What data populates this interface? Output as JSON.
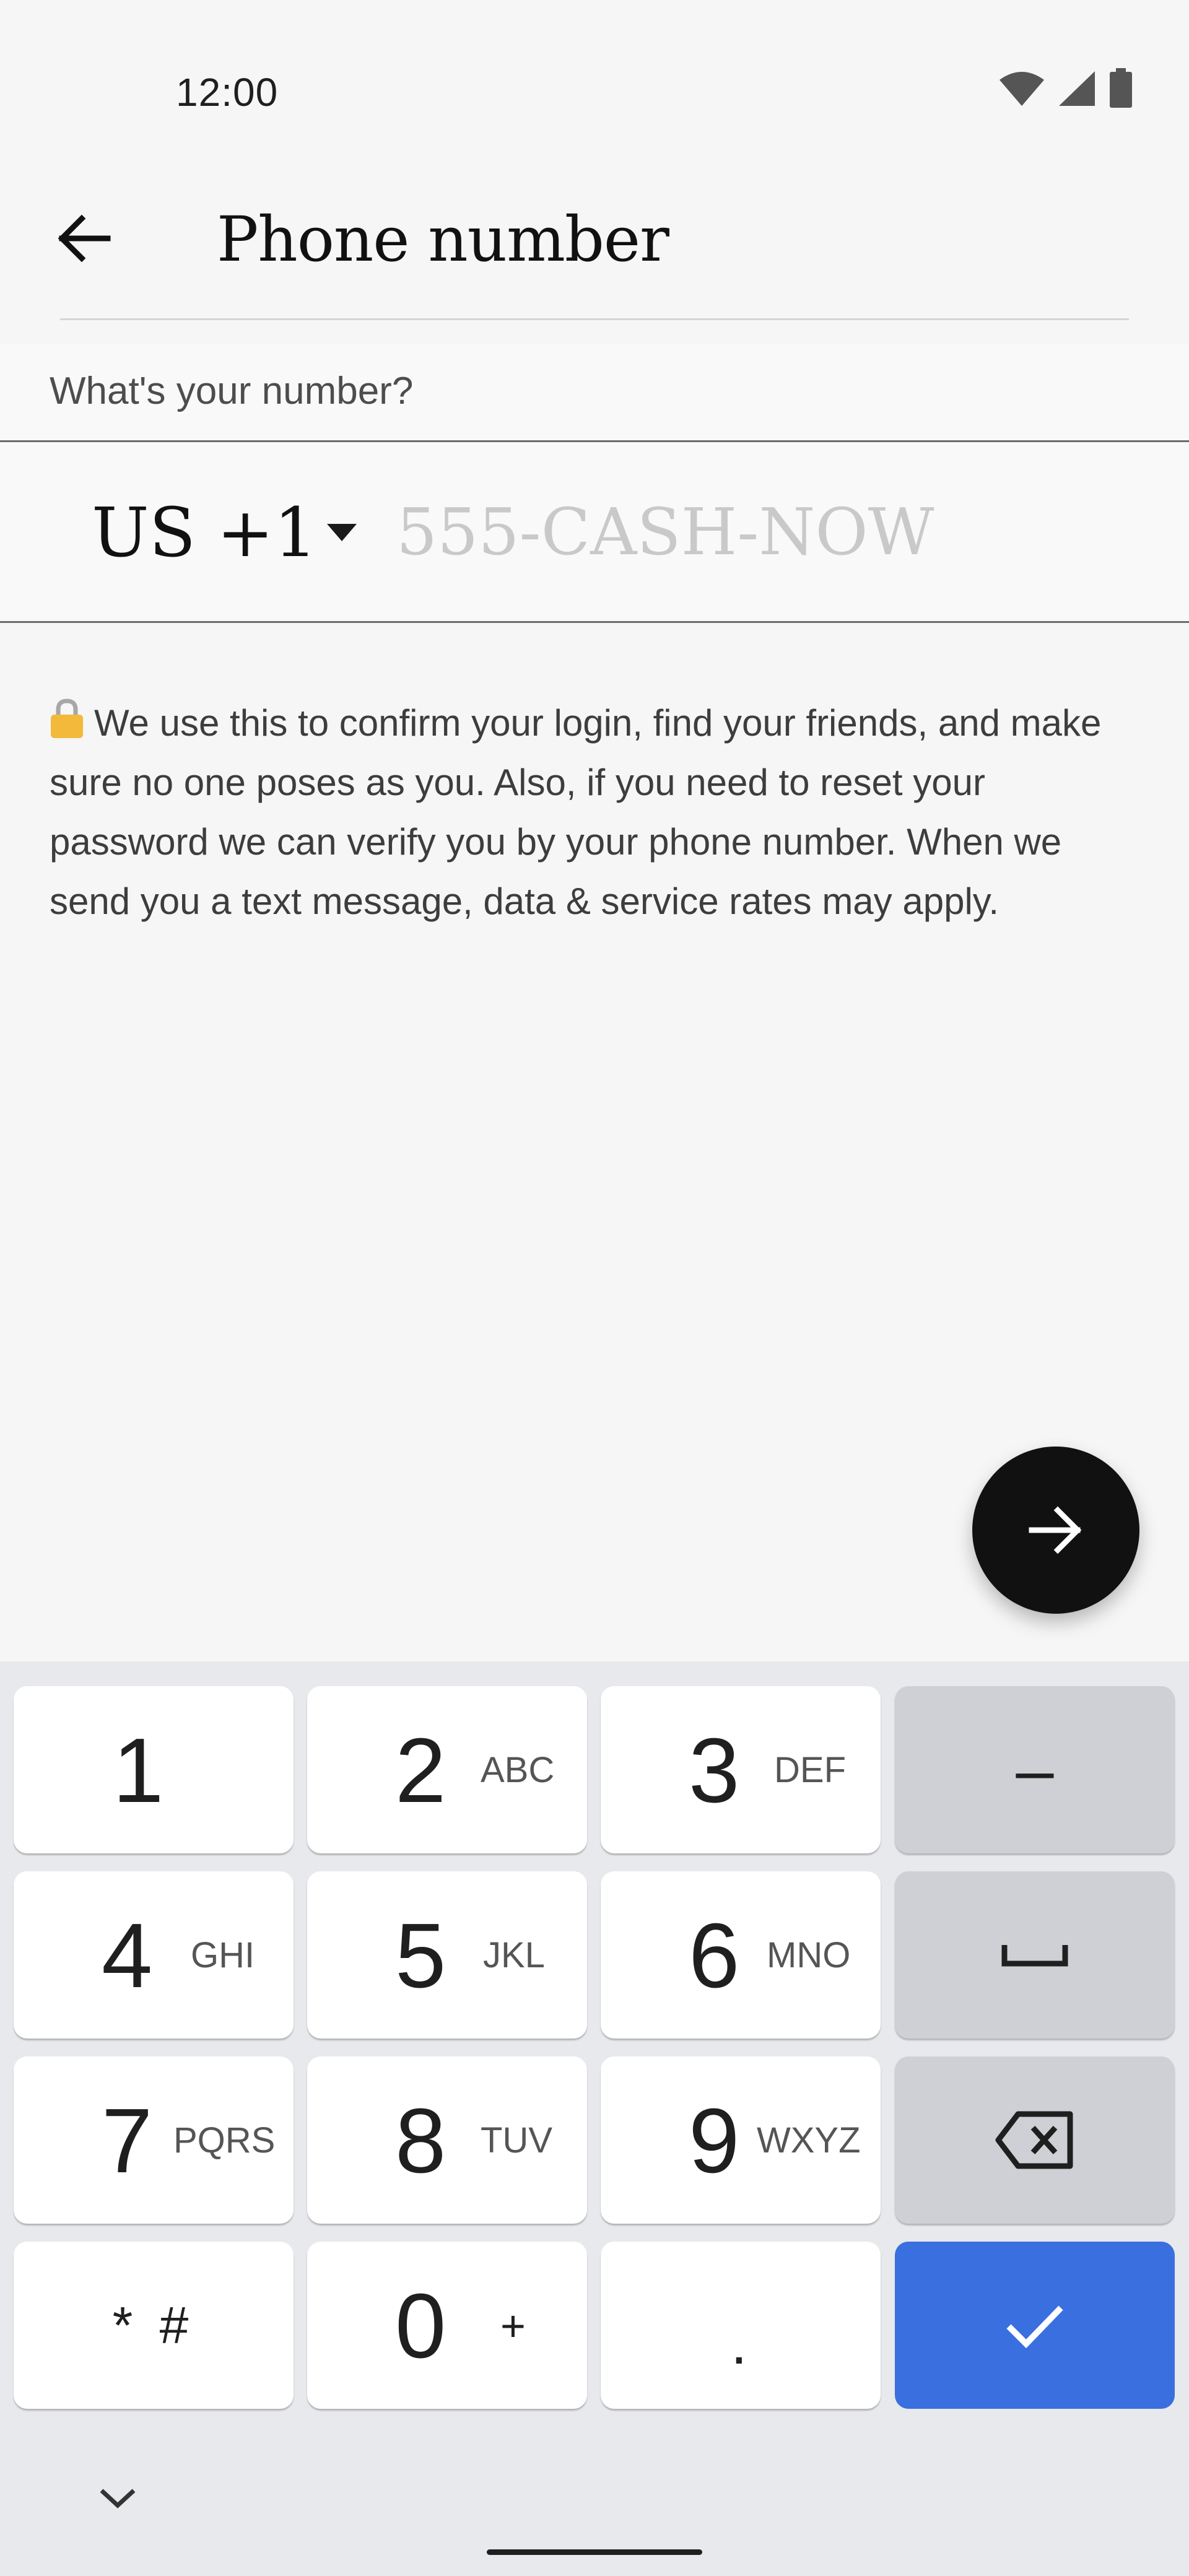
{
  "status_bar": {
    "time": "12:00",
    "icons": [
      "wifi-icon",
      "signal-icon",
      "battery-icon"
    ]
  },
  "app_bar": {
    "title": "Phone number",
    "back_icon": "arrow-back-icon"
  },
  "form": {
    "section_label": "What's your number?",
    "country_code": "US",
    "dial_code": "+1",
    "phone_value": "",
    "phone_placeholder": "555-CASH-NOW",
    "info_text": "We use this to confirm your login, find your friends, and make sure no one poses as you. Also, if you need to reset your password we can verify you by your phone number. When we send you a text message, data & service rates may apply.",
    "info_icon": "lock-icon"
  },
  "fab": {
    "icon": "arrow-forward-icon",
    "color": "#111111"
  },
  "keyboard": {
    "keys": [
      {
        "num": "1",
        "letters": ""
      },
      {
        "num": "2",
        "letters": "ABC"
      },
      {
        "num": "3",
        "letters": "DEF"
      },
      {
        "num": "4",
        "letters": "GHI"
      },
      {
        "num": "5",
        "letters": "JKL"
      },
      {
        "num": "6",
        "letters": "MNO"
      },
      {
        "num": "7",
        "letters": "PQRS"
      },
      {
        "num": "8",
        "letters": "TUV"
      },
      {
        "num": "9",
        "letters": "WXYZ"
      },
      {
        "num": "0",
        "letters": "+"
      }
    ],
    "symbols_label": "* #",
    "dot_label": ".",
    "dash_label": "–",
    "done_color": "#3a6fdf",
    "func_color": "#cfd0d5"
  }
}
